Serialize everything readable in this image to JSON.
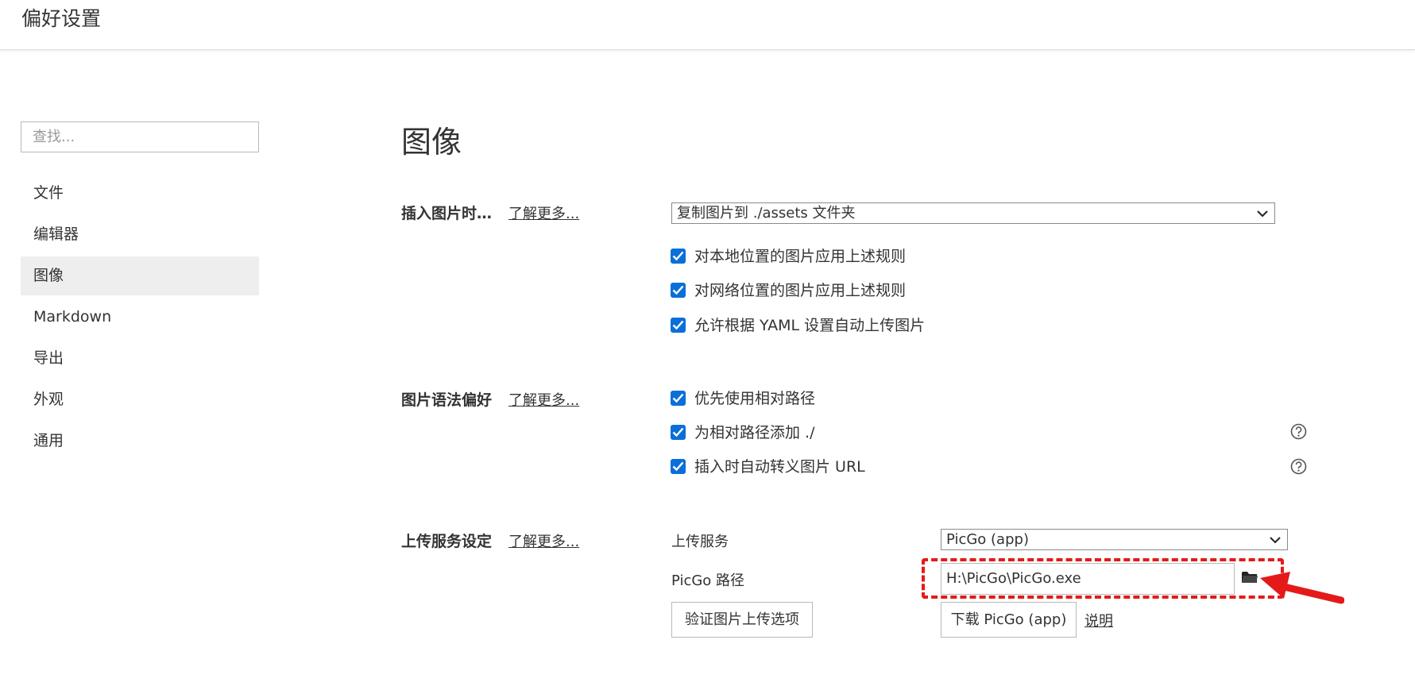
{
  "window": {
    "title": "偏好设置"
  },
  "sidebar": {
    "search_placeholder": "查找...",
    "items": [
      {
        "label": "文件"
      },
      {
        "label": "编辑器"
      },
      {
        "label": "图像",
        "active": true
      },
      {
        "label": "Markdown"
      },
      {
        "label": "导出"
      },
      {
        "label": "外观"
      },
      {
        "label": "通用"
      }
    ]
  },
  "main": {
    "heading": "图像",
    "insert": {
      "label": "插入图片时…",
      "learn_more": "了解更多...",
      "action_selected": "复制图片到 ./assets 文件夹",
      "options": [
        {
          "label": "对本地位置的图片应用上述规则",
          "checked": true
        },
        {
          "label": "对网络位置的图片应用上述规则",
          "checked": true
        },
        {
          "label": "允许根据 YAML 设置自动上传图片",
          "checked": true
        }
      ]
    },
    "syntax": {
      "label": "图片语法偏好",
      "learn_more": "了解更多...",
      "options": [
        {
          "label": "优先使用相对路径",
          "checked": true
        },
        {
          "label": "为相对路径添加 ./",
          "checked": true
        },
        {
          "label": "插入时自动转义图片 URL",
          "checked": true
        }
      ]
    },
    "upload": {
      "label": "上传服务设定",
      "learn_more": "了解更多...",
      "service_label": "上传服务",
      "service_selected": "PicGo (app)",
      "path_label": "PicGo 路径",
      "path_value": "H:\\PicGo\\PicGo.exe",
      "verify_button": "验证图片上传选项",
      "download_button": "下载 PicGo (app)",
      "explain_link": "说明"
    }
  },
  "colors": {
    "checkbox": "#0b6fd9",
    "annotation": "#e41a1a",
    "active_nav": "#eeeeee"
  }
}
